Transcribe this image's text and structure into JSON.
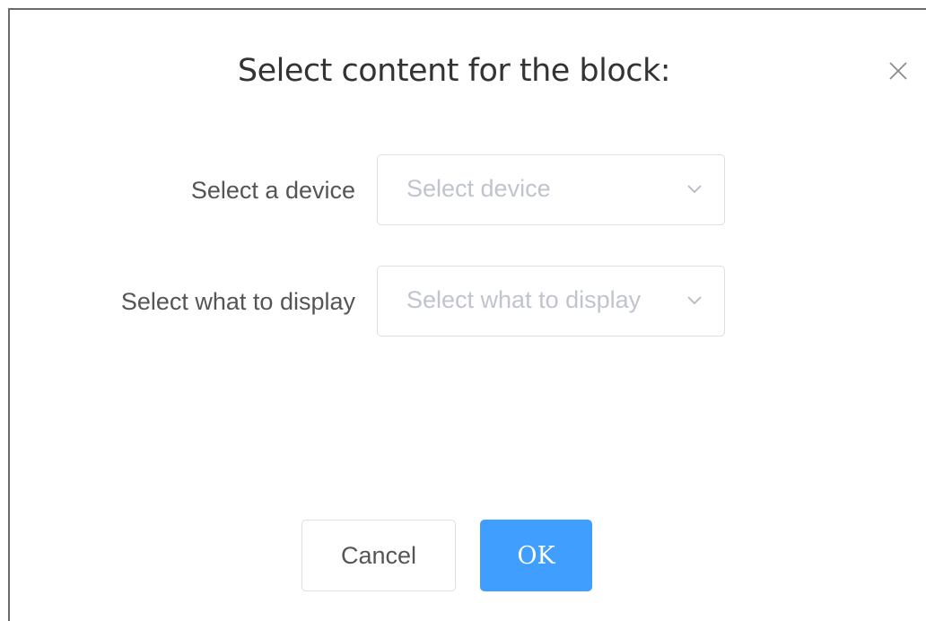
{
  "dialog": {
    "title": "Select content for the block:",
    "close_icon": "close-icon"
  },
  "form": {
    "device": {
      "label": "Select a device",
      "placeholder": "Select device"
    },
    "display": {
      "label": "Select what to display",
      "placeholder": "Select what to display"
    }
  },
  "footer": {
    "cancel_label": "Cancel",
    "ok_label": "OK"
  },
  "colors": {
    "primary": "#409eff",
    "border": "#dcdfe6",
    "placeholder": "#c0c4cc",
    "text": "#555555"
  }
}
